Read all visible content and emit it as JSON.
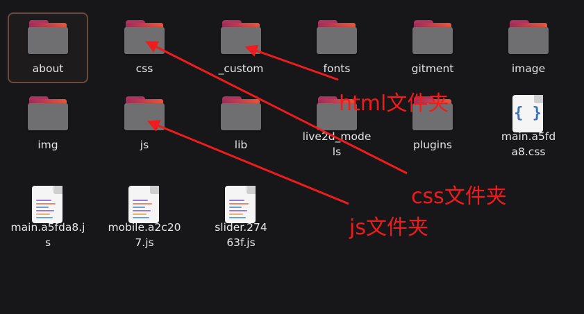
{
  "files": [
    {
      "name": "about",
      "type": "folder",
      "selected": true
    },
    {
      "name": "css",
      "type": "folder"
    },
    {
      "name": "_custom",
      "type": "folder"
    },
    {
      "name": "fonts",
      "type": "folder"
    },
    {
      "name": "gitment",
      "type": "folder"
    },
    {
      "name": "image",
      "type": "folder"
    },
    {
      "name": "img",
      "type": "folder"
    },
    {
      "name": "js",
      "type": "folder"
    },
    {
      "name": "lib",
      "type": "folder"
    },
    {
      "name": "live2d_models",
      "type": "folder"
    },
    {
      "name": "plugins",
      "type": "folder"
    },
    {
      "name": "main.a5fda8.css",
      "type": "css-file"
    },
    {
      "name": "main.a5fda8.js",
      "type": "js-file"
    },
    {
      "name": "mobile.a2c207.js",
      "type": "js-file"
    },
    {
      "name": "slider.27463f.js",
      "type": "js-file"
    }
  ],
  "annotations": {
    "html_label": "html文件夹",
    "css_label": "css文件夹",
    "js_label": "js文件夹"
  },
  "colors": {
    "background": "#171719",
    "annotation": "#ee1c1c",
    "folder_accent": "#e8553a",
    "selection_border": "#6a4a3a"
  }
}
